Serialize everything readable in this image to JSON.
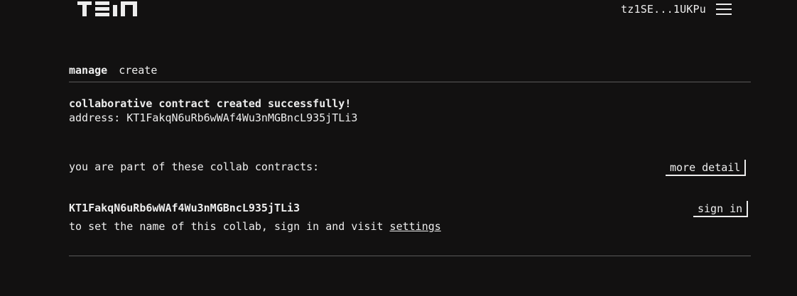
{
  "header": {
    "logo_text": "TEIA",
    "wallet_address": "tz1SE...1UKPu",
    "menu_icon": "hamburger-menu-icon"
  },
  "tabs": [
    {
      "label": "manage",
      "active": true
    },
    {
      "label": "create",
      "active": false
    }
  ],
  "success": {
    "title": "collaborative contract created successfully!",
    "address_label": "address:",
    "address": "KT1FakqN6uRb6wWAf4Wu3nMGBncL935jTLi3"
  },
  "collabs": {
    "heading": "you are part of these collab contracts:",
    "more_detail_label": "more detail",
    "items": [
      {
        "address": "KT1FakqN6uRb6wWAf4Wu3nMGBncL935jTLi3",
        "sign_in_label": "sign in",
        "hint_text": "to set the name of this collab, sign in and visit",
        "settings_link": "settings"
      }
    ]
  },
  "colors": {
    "background": "#121111",
    "text": "#ededed",
    "divider": "#5a5a5a"
  }
}
